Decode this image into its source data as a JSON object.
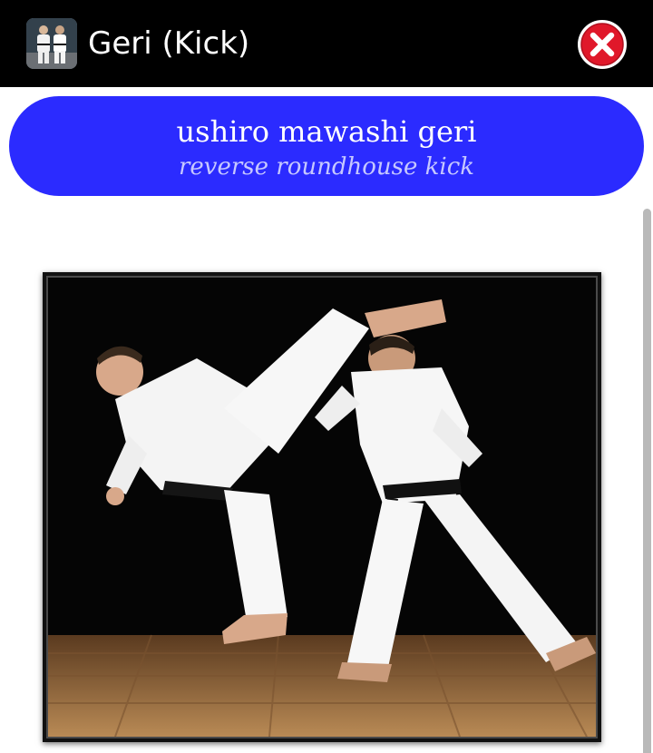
{
  "app_bar": {
    "title": "Geri (Kick)",
    "icon": "karate-app-icon",
    "close_icon": "close-icon"
  },
  "banner": {
    "title": "ushiro mawashi geri",
    "subtitle": "reverse roundhouse kick",
    "color": "#2b2bff"
  },
  "photo": {
    "subject": "karate-kick-photo"
  },
  "colors": {
    "app_bar": "#000000",
    "background": "#ffffff",
    "close_red": "#e0182a"
  }
}
